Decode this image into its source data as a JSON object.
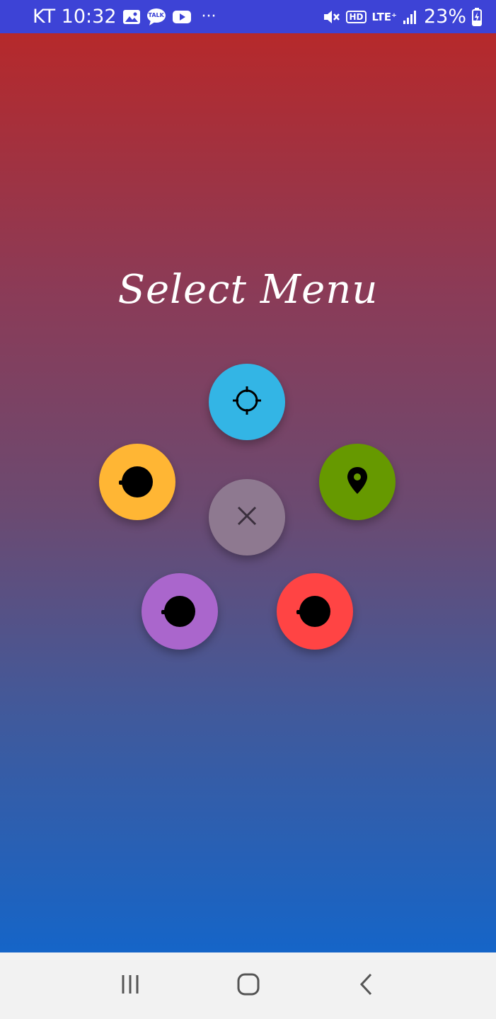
{
  "status_bar": {
    "carrier_time": "KT 10:32",
    "more": "···",
    "talk_badge": "TALK",
    "hd_badge": "HD",
    "lte_label": "LTE⁺",
    "battery": "23%"
  },
  "screen": {
    "title": "Select Menu"
  },
  "menu": {
    "items": [
      {
        "name": "crosshair",
        "icon": "crosshair-icon",
        "color": "#33b5e5"
      },
      {
        "name": "yellow",
        "icon": "dot-icon",
        "color": "#ffb634"
      },
      {
        "name": "location",
        "icon": "location-pin-icon",
        "color": "#669900"
      },
      {
        "name": "close",
        "icon": "close-icon",
        "color": "#8e7990"
      },
      {
        "name": "purple",
        "icon": "dot-icon",
        "color": "#aa66cc"
      },
      {
        "name": "red",
        "icon": "dot-icon",
        "color": "#ff4444"
      }
    ]
  },
  "nav_bar": {
    "buttons": [
      "recent-apps-icon",
      "home-icon",
      "back-icon"
    ]
  }
}
